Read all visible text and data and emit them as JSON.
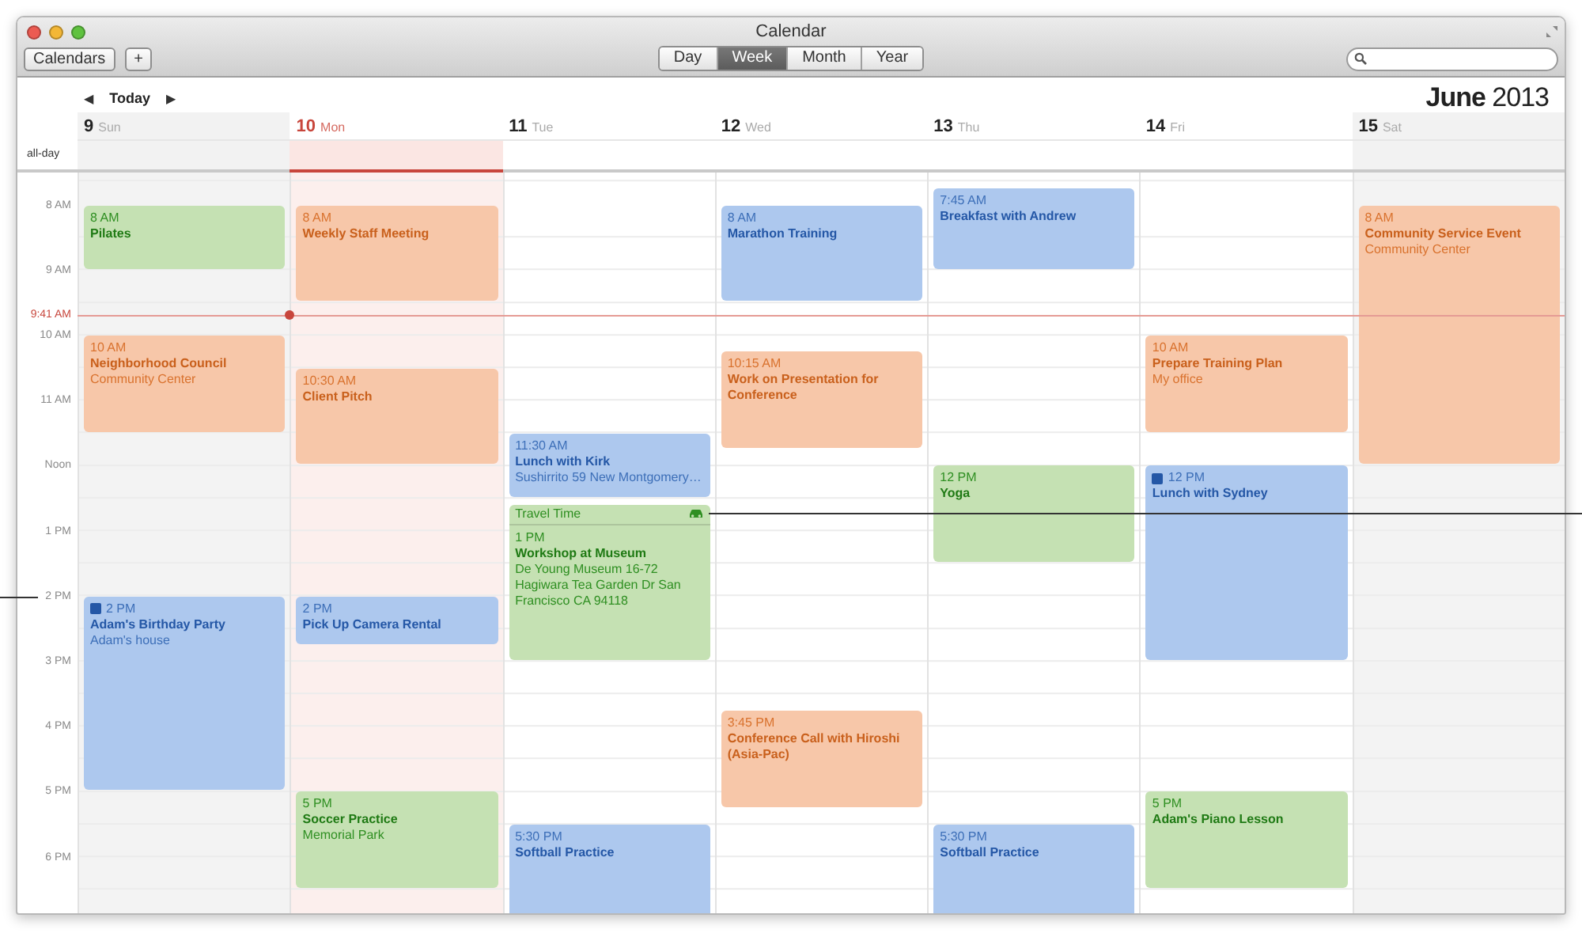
{
  "window": {
    "title": "Calendar"
  },
  "toolbar": {
    "calendars_button": "Calendars",
    "add_button": "+",
    "views": [
      {
        "label": "Day",
        "selected": false
      },
      {
        "label": "Week",
        "selected": true
      },
      {
        "label": "Month",
        "selected": false
      },
      {
        "label": "Year",
        "selected": false
      }
    ]
  },
  "header": {
    "prev": "◀",
    "today": "Today",
    "next": "▶",
    "month_title": "**June** 2013"
  },
  "all_day_label": "all-day",
  "time_labels": [
    "8 AM",
    "9 AM",
    "10 AM",
    "11 AM",
    "Noon",
    "1 PM",
    "2 PM",
    "3 PM",
    "4 PM",
    "5 PM",
    "6 PM"
  ],
  "now_label": "9:41 AM",
  "days": [
    {
      "number": "9",
      "weekday": "Sun",
      "today": false,
      "weekend": true,
      "events": [
        {
          "time": "8 AM",
          "title": "Pilates",
          "kind": "hour",
          "color": "#c5e1b3",
          "badge": false
        },
        {
          "time": "10 AM",
          "title": "Neighborhood Council",
          "location": "Community Center",
          "kind": "ninety",
          "color": "#f7c7a9",
          "badge": false
        },
        {
          "time": "2 PM",
          "title": "Adam's Birthday Party",
          "location": "Adam's house",
          "kind": "three",
          "color": "#adc8ee",
          "badge": true
        }
      ]
    },
    {
      "number": "10",
      "weekday": "Mon",
      "today": true,
      "weekend": false,
      "events": [
        {
          "time": "8 AM",
          "title": "Weekly Staff Meeting",
          "kind": "ninety",
          "color": "#f7c7a9",
          "badge": false
        },
        {
          "time": "10:30 AM",
          "title": "Client Pitch",
          "kind": "ninety",
          "color": "#f7c7a9",
          "badge": false
        },
        {
          "time": "2 PM",
          "title": "Pick Up Camera Rental",
          "kind": "short",
          "color": "#adc8ee",
          "badge": false
        },
        {
          "time": "5 PM",
          "title": "Soccer Practice",
          "location": "Memorial Park",
          "kind": "ninety",
          "color": "#c5e1b3",
          "badge": false
        }
      ]
    },
    {
      "number": "11",
      "weekday": "Tue",
      "today": false,
      "weekend": false,
      "events": [
        {
          "time": "11:30 AM",
          "title": "Lunch with Kirk",
          "location": "Sushirrito 59 New Montgomery…",
          "kind": "hour",
          "color": "#adc8ee",
          "badge": false
        },
        {
          "time": "1 PM",
          "title": "Workshop at Museum",
          "location": "De Young Museum 16-72 Hagiwara Tea Garden Dr San Francisco CA 94118",
          "kind": "two",
          "color": "#c5e1b3",
          "badge": false,
          "travel": "Travel Time"
        },
        {
          "time": "5:30 PM",
          "title": "Softball Practice",
          "kind": "ninety",
          "color": "#adc8ee",
          "badge": false
        }
      ]
    },
    {
      "number": "12",
      "weekday": "Wed",
      "today": false,
      "weekend": false,
      "events": [
        {
          "time": "8 AM",
          "title": "Marathon Training",
          "kind": "ninety",
          "color": "#adc8ee",
          "badge": false
        },
        {
          "time": "10:15 AM",
          "title": "Work on Presentation for Conference",
          "kind": "ninety",
          "color": "#f7c7a9",
          "badge": false
        },
        {
          "time": "3:45 PM",
          "title": "Conference Call with Hiroshi (Asia-Pac)",
          "kind": "ninety",
          "color": "#f7c7a9",
          "badge": false
        }
      ]
    },
    {
      "number": "13",
      "weekday": "Thu",
      "today": false,
      "weekend": false,
      "events": [
        {
          "time": "7:45 AM",
          "title": "Breakfast with Andrew",
          "kind": "long",
          "color": "#adc8ee",
          "badge": false
        },
        {
          "time": "12 PM",
          "title": "Yoga",
          "kind": "ninety",
          "color": "#c5e1b3",
          "badge": false
        },
        {
          "time": "5:30 PM",
          "title": "Softball Practice",
          "kind": "ninety",
          "color": "#adc8ee",
          "badge": false
        }
      ]
    },
    {
      "number": "14",
      "weekday": "Fri",
      "today": false,
      "weekend": false,
      "events": [
        {
          "time": "10 AM",
          "title": "Prepare Training Plan",
          "location": "My office",
          "kind": "ninety",
          "color": "#f7c7a9",
          "badge": false
        },
        {
          "time": "12 PM",
          "title": "Lunch with Sydney",
          "kind": "three",
          "color": "#adc8ee",
          "badge": true
        },
        {
          "time": "5 PM",
          "title": "Adam's Piano Lesson",
          "kind": "ninety",
          "color": "#c5e1b3",
          "badge": false
        }
      ]
    },
    {
      "number": "15",
      "weekday": "Sat",
      "today": false,
      "weekend": true,
      "events": [
        {
          "time": "8 AM",
          "title": "Community Service Event",
          "location": "Community Center",
          "kind": "four",
          "color": "#f7c7a9",
          "badge": false
        }
      ]
    }
  ]
}
